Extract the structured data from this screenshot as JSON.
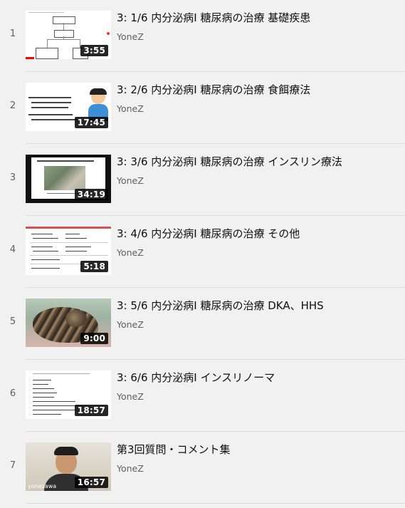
{
  "playlist": [
    {
      "index": "1",
      "title": "3: 1/6 内分泌病Ⅰ 糖尿病の治療 基礎疾患",
      "channel": "YoneZ",
      "duration": "3:55"
    },
    {
      "index": "2",
      "title": "3: 2/6 内分泌病Ⅰ 糖尿病の治療 食餌療法",
      "channel": "YoneZ",
      "duration": "17:45"
    },
    {
      "index": "3",
      "title": "3: 3/6 内分泌病Ⅰ 糖尿病の治療 インスリン療法",
      "channel": "YoneZ",
      "duration": "34:19"
    },
    {
      "index": "4",
      "title": "3: 4/6 内分泌病Ⅰ 糖尿病の治療 その他",
      "channel": "YoneZ",
      "duration": "5:18"
    },
    {
      "index": "5",
      "title": "3: 5/6 内分泌病Ⅰ 糖尿病の治療 DKA、HHS",
      "channel": "YoneZ",
      "duration": "9:00"
    },
    {
      "index": "6",
      "title": "3: 6/6 内分泌病Ⅰ インスリノーマ",
      "channel": "YoneZ",
      "duration": "18:57"
    },
    {
      "index": "7",
      "title": "第3回質問・コメント集",
      "channel": "YoneZ",
      "duration": "16:57"
    }
  ],
  "thumbnails": {
    "t1": {
      "box_top": "基礎疾患",
      "box_mid": "糖尿病",
      "box_left": "基礎疾患",
      "progress": 0.1
    },
    "t3": {
      "header": "1980年 経済成長とインスリン製剤"
    },
    "t4": {
      "rows": [
        "インスリン",
        "SU剤",
        "ビグアナイド",
        "αグリコシダーゼ",
        "SGLT2阻害"
      ]
    },
    "t6": {
      "bullets": [
        "腫瘍",
        "低血糖",
        "激しい運動",
        "トイメ体重",
        "アジソン病"
      ]
    },
    "t7": {
      "caption": "yonezawa"
    }
  }
}
